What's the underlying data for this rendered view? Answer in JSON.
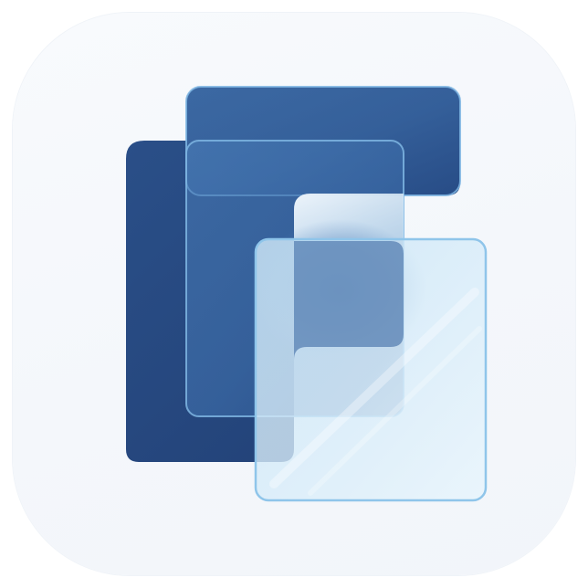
{
  "app_icon": {
    "kind": "app-icon",
    "colors": {
      "background": "#f5f8fc",
      "navy": "#264a82",
      "mid_blue": "#3f6fa8",
      "light_blue": "#a9d2ee",
      "glass_edge": "#8fc5ea",
      "highlight": "#e6f3fc"
    }
  }
}
